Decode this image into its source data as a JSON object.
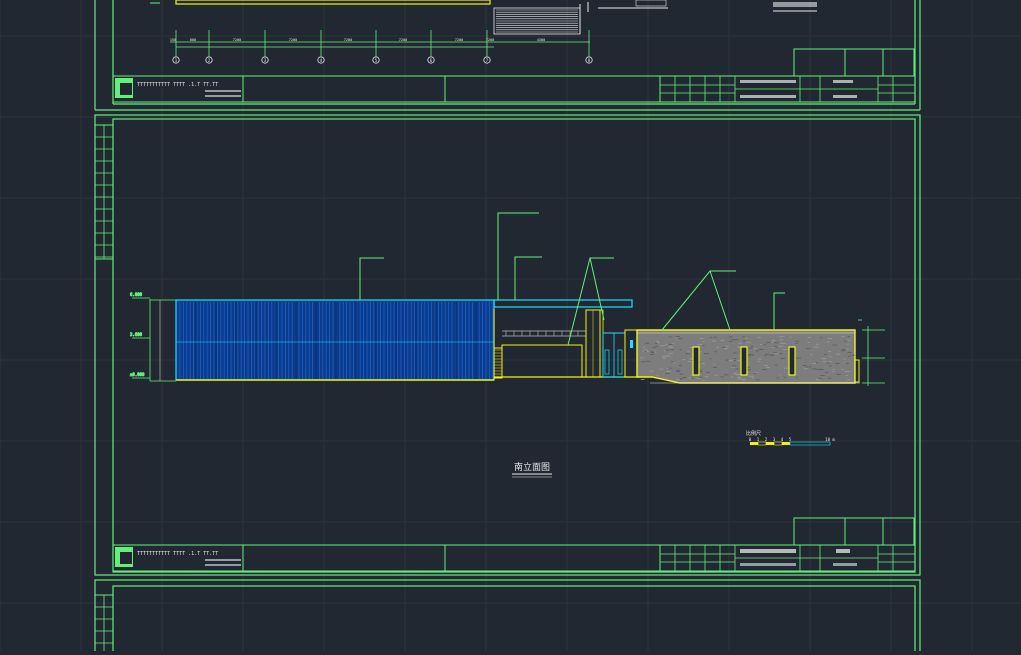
{
  "colors": {
    "background": "#222831",
    "grid": "#2c333c",
    "frame": "#63f07a",
    "yellow": "#f2f21a",
    "cyan": "#20e0ff",
    "glass_fill": "#0a3b8c",
    "stone_fill": "#7d7d7d",
    "white": "#e8e8e8"
  },
  "top_sheet": {
    "dims": [
      "150",
      "600",
      "7200",
      "7200",
      "7200",
      "7200",
      "7200",
      "7200",
      "4300"
    ],
    "axis_marks": [
      "1",
      "2",
      "3",
      "4",
      "5",
      "6",
      "7",
      "8"
    ],
    "title_block_left": "TTTTTTTTTTT  TTTT  .1.T  TT.TT"
  },
  "main_sheet": {
    "drawing_title": "南立面图",
    "scale_bar_label": "比例尺",
    "scale_bar_ticks": [
      "0",
      "1",
      "2",
      "3",
      "4",
      "5",
      "10 m"
    ],
    "title_block_left": "TTTTTTTTTTT  TTTT  .1.T  TT.TT",
    "level_marks": [
      "±0.000",
      "3.600",
      "6.000"
    ]
  }
}
